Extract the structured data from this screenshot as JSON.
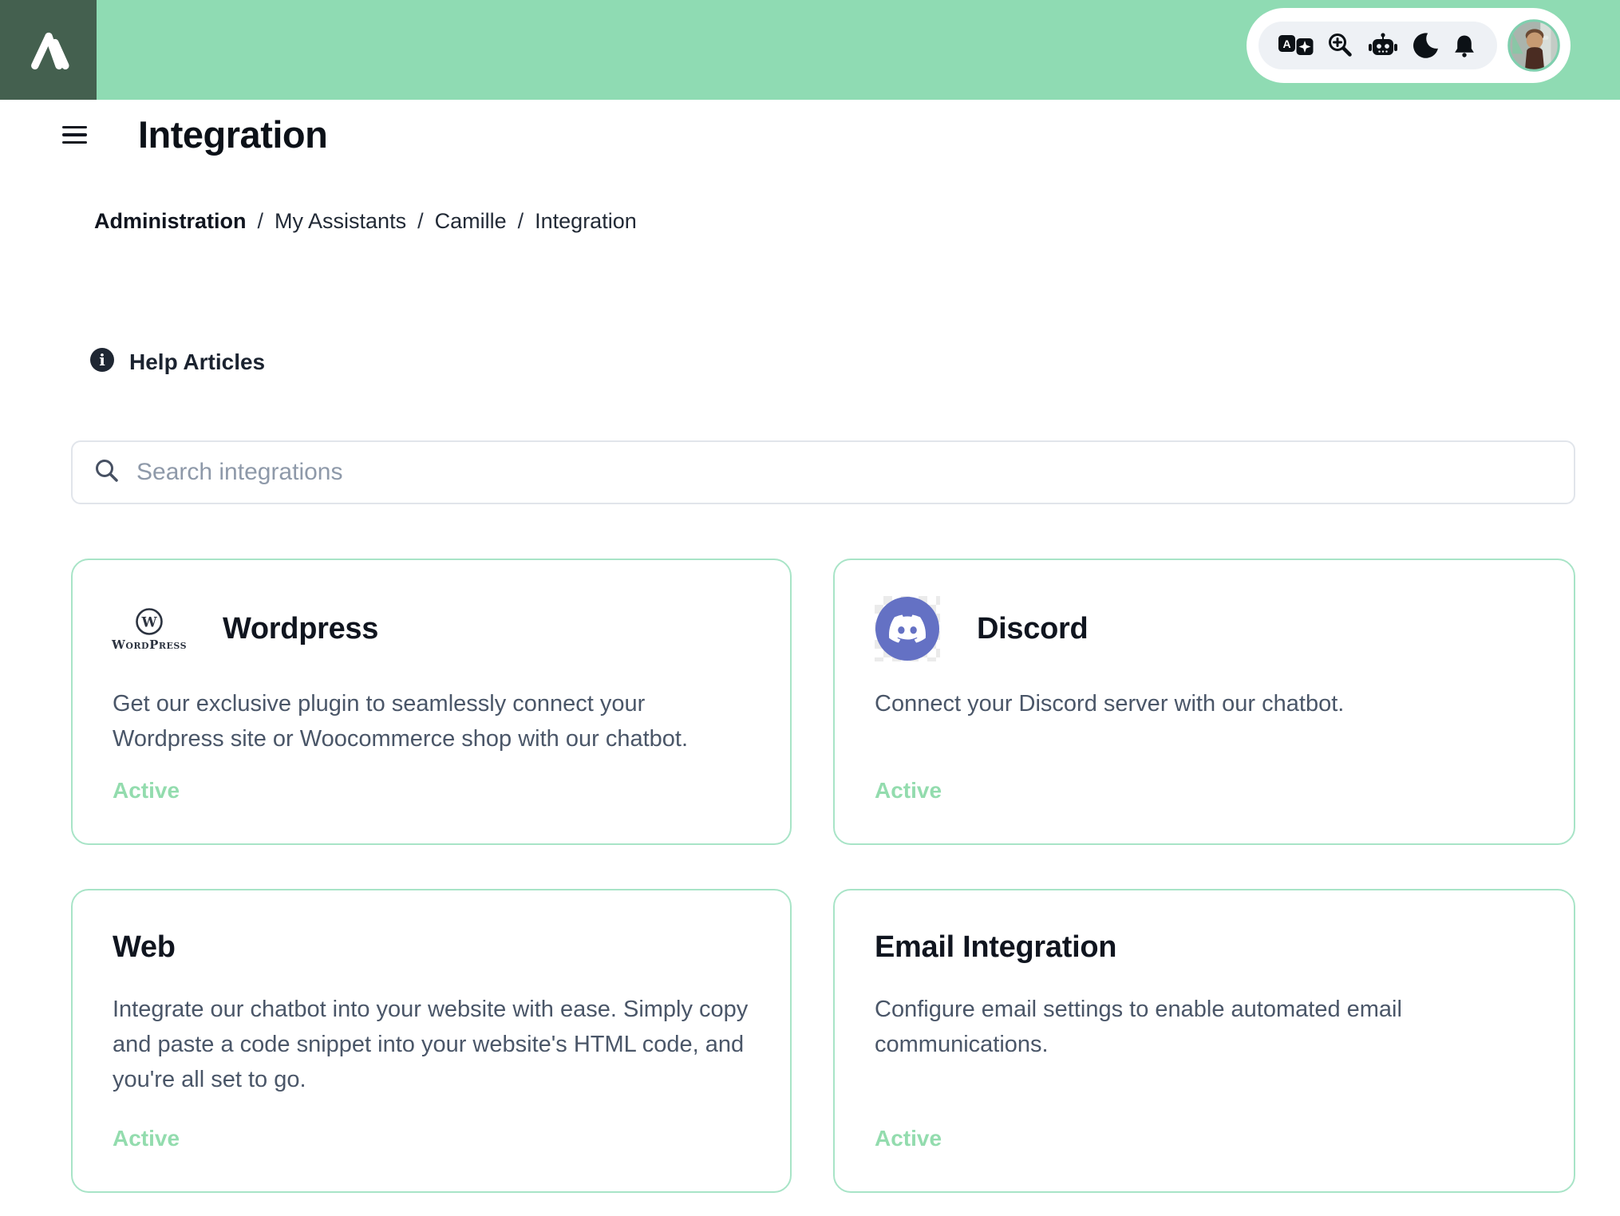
{
  "colors": {
    "header_bg": "#8fdbb3",
    "brand_bg": "#44604f",
    "card_border": "#a8e4c7",
    "active_green": "#93dcae",
    "discord_brand": "#6471c4",
    "text_dark": "#10151f",
    "text_slate": "#4a5668"
  },
  "topbar": {
    "icons": [
      "translate-icon",
      "zoom-in-icon",
      "robot-icon",
      "dark-mode-moon-icon",
      "notifications-bell-icon"
    ],
    "avatar": "user-profile-photo"
  },
  "page": {
    "title": "Integration",
    "breadcrumb": {
      "items": [
        "Administration",
        "My Assistants",
        "Camille",
        "Integration"
      ],
      "separator": "/"
    },
    "help": {
      "label": "Help Articles"
    },
    "search": {
      "placeholder": "Search integrations"
    }
  },
  "cards": [
    {
      "title": "Wordpress",
      "logo": "wordpress-logo",
      "logo_letter": "W",
      "logo_text": "WordPress",
      "description": "Get our exclusive plugin to seamlessly connect your Wordpress site or Woocommerce shop with our chatbot.",
      "status": "Active"
    },
    {
      "title": "Discord",
      "logo": "discord-logo",
      "description": "Connect your Discord server with our chatbot.",
      "status": "Active"
    },
    {
      "title": "Web",
      "logo": null,
      "description": "Integrate our chatbot into your website with ease. Simply copy and paste a code snippet into your website's HTML code, and you're all set to go.",
      "status": "Active"
    },
    {
      "title": "Email Integration",
      "logo": null,
      "description": "Configure email settings to enable automated email communications.",
      "status": "Active"
    }
  ]
}
